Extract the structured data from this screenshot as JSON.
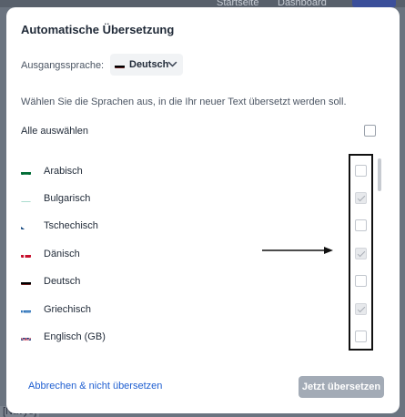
{
  "background": {
    "tabs": [
      "Startseite",
      "Dashboard"
    ],
    "left_text": "[Navyo]"
  },
  "modal": {
    "title": "Automatische Übersetzung",
    "source_label": "Ausgangssprache:",
    "source_language": "Deutsch",
    "instruction": "Wählen Sie die Sprachen aus, in die Ihr neuer Text übersetzt werden soll.",
    "select_all_label": "Alle auswählen",
    "select_all_checked": false,
    "languages": [
      {
        "name": "Arabisch",
        "flag": "flag-saudi-arabia-icon",
        "checked": false
      },
      {
        "name": "Bulgarisch",
        "flag": "flag-bulgaria-icon",
        "checked": true
      },
      {
        "name": "Tschechisch",
        "flag": "flag-czech-icon",
        "checked": false
      },
      {
        "name": "Dänisch",
        "flag": "flag-denmark-icon",
        "checked": true
      },
      {
        "name": "Deutsch",
        "flag": "flag-germany-icon",
        "checked": false
      },
      {
        "name": "Griechisch",
        "flag": "flag-greece-icon",
        "checked": true
      },
      {
        "name": "Englisch (GB)",
        "flag": "flag-uk-icon",
        "checked": false
      }
    ],
    "cancel_label": "Abbrechen & nicht übersetzen",
    "submit_label": "Jetzt übersetzen"
  },
  "colors": {
    "accent_link": "#1f5fd1",
    "disabled_button": "#a3abb6",
    "overlay": "#6b7480"
  }
}
